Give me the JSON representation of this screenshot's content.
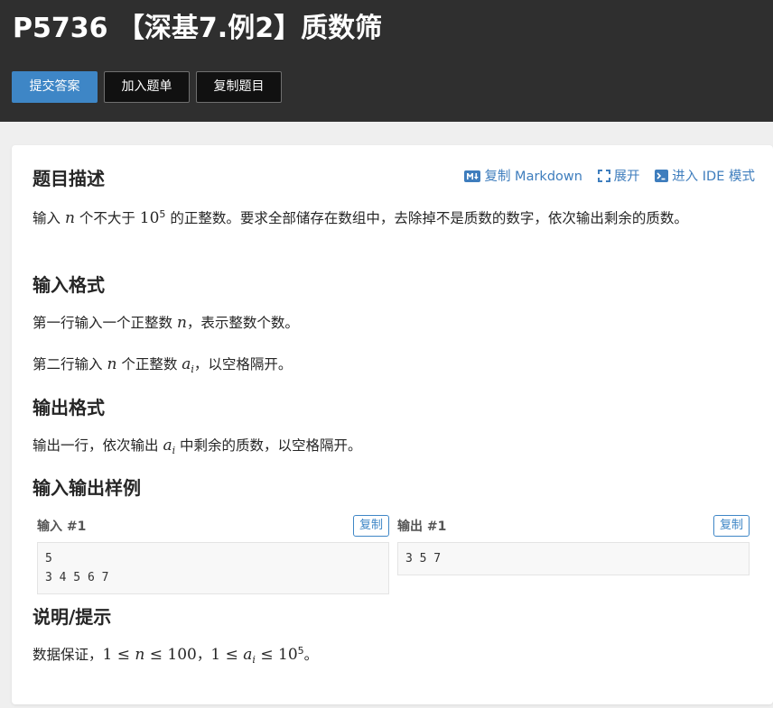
{
  "problem": {
    "title": "P5736 【深基7.例2】质数筛"
  },
  "toolbar": {
    "submit_label": "提交答案",
    "add_list_label": "加入题单",
    "copy_problem_label": "复制题目"
  },
  "card_actions": {
    "copy_markdown": "复制 Markdown",
    "expand": "展开",
    "ide_mode": "进入 IDE 模式"
  },
  "sections": {
    "description": {
      "heading": "题目描述",
      "text_1": "输入 ",
      "var_n": "n",
      "text_2": " 个不大于 ",
      "base": "10",
      "exp": "5",
      "text_3": " 的正整数。要求全部储存在数组中，去除掉不是质数的数字，依次输出剩余的质数。"
    },
    "input_format": {
      "heading": "输入格式",
      "line1_a": "第一行输入一个正整数 ",
      "line1_var": "n",
      "line1_b": "，表示整数个数。",
      "line2_a": "第二行输入 ",
      "line2_var": "n",
      "line2_b": " 个正整数 ",
      "line2_var2": "a",
      "line2_sub": "i",
      "line2_c": "，以空格隔开。"
    },
    "output_format": {
      "heading": "输出格式",
      "text_a": "输出一行，依次输出 ",
      "var": "a",
      "sub": "i",
      "text_b": " 中剩余的质数，以空格隔开。"
    },
    "samples": {
      "heading": "输入输出样例",
      "input_label": "输入 #1",
      "output_label": "输出 #1",
      "copy_label": "复制",
      "input_content": "5\n3 4 5 6 7",
      "output_content": "3 5 7"
    },
    "hint": {
      "heading": "说明/提示",
      "text_a": "数据保证，",
      "m1": "1",
      "le1": " ≤ ",
      "mn": "n",
      "le2": " ≤ ",
      "m100": "100",
      "comma": "，",
      "m1b": "1",
      "le3": " ≤ ",
      "ma": "a",
      "mi": "i",
      "le4": " ≤ ",
      "m10": "10",
      "m5": "5",
      "period": "。"
    }
  },
  "colors": {
    "header_bg": "#2f2f2f",
    "primary": "#3e86c6",
    "link": "#3e7dbd",
    "page_bg": "#efefef"
  }
}
